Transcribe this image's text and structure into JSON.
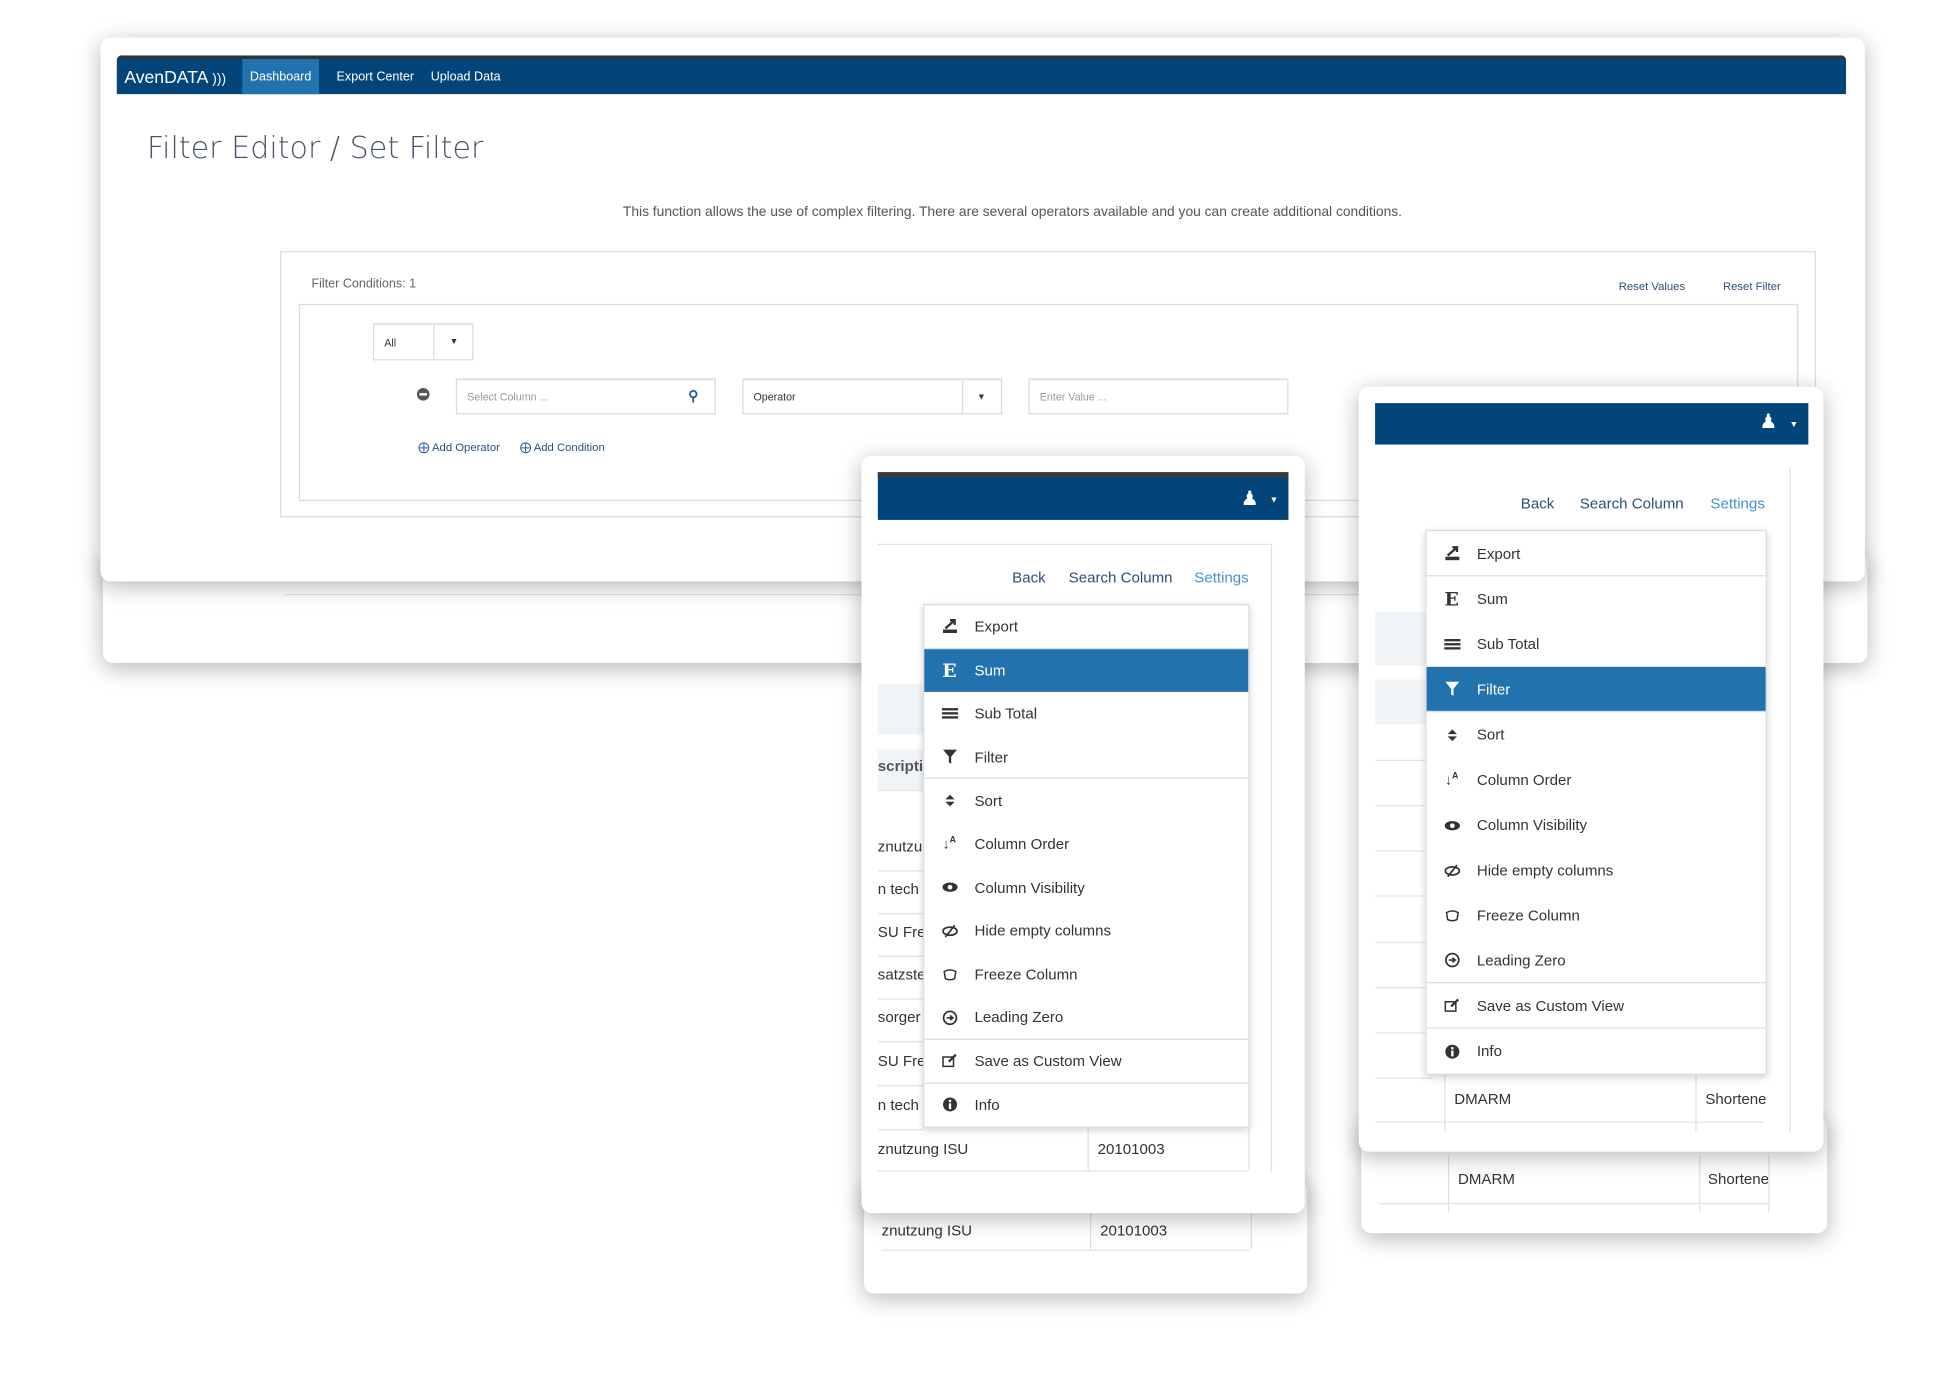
{
  "app": {
    "logo": "AvenDATA",
    "nav": [
      {
        "label": "Dashboard",
        "active": true
      },
      {
        "label": "Export Center"
      },
      {
        "label": "Upload Data"
      }
    ]
  },
  "page": {
    "title": "Filter Editor / Set Filter",
    "description": "This function allows the use of complex filtering. There are several operators available and you can create additional conditions.",
    "filter_conditions_label": "Filter Conditions: 1",
    "reset_values": "Reset Values",
    "reset_filter": "Reset Filter",
    "match_select": "All",
    "column_placeholder": "Select Column ...",
    "operator_select": "Operator",
    "value_placeholder": "Enter Value ...",
    "add_operator": "Add Operator",
    "add_condition": "Add Condition"
  },
  "colors": {
    "navbar": "#02457a",
    "active_tab": "#2173b0",
    "highlight": "#2272ad",
    "settings_link": "#4a90d9"
  },
  "toolbar": {
    "back": "Back",
    "search_column": "Search Column",
    "settings": "Settings"
  },
  "menu_items": [
    {
      "label": "Export",
      "icon": "export-icon"
    },
    {
      "label": "Sum",
      "icon": "sum-icon"
    },
    {
      "label": "Sub Total",
      "icon": "list-icon"
    },
    {
      "label": "Filter",
      "icon": "filter-icon"
    },
    {
      "label": "Sort",
      "icon": "sort-icon"
    },
    {
      "label": "Column Order",
      "icon": "sort-alpha-icon"
    },
    {
      "label": "Column Visibility",
      "icon": "eye-icon"
    },
    {
      "label": "Hide empty columns",
      "icon": "eye-slash-icon"
    },
    {
      "label": "Freeze Column",
      "icon": "freeze-icon"
    },
    {
      "label": "Leading Zero",
      "icon": "arrow-circle-icon"
    },
    {
      "label": "Save as Custom View",
      "icon": "edit-icon"
    },
    {
      "label": "Info",
      "icon": "info-icon"
    }
  ],
  "middle_window": {
    "selected": "Sum",
    "table_fragments": [
      "scriptic",
      "znutzu",
      "n tech",
      "SU Frei",
      "satzste",
      "sorger",
      "SU Frei",
      "n tech"
    ],
    "last_row": {
      "col1": "znutzung ISU",
      "col2": "20101003"
    },
    "behind_row": {
      "col1": "znutzung ISU",
      "col2": "20101003"
    }
  },
  "right_window": {
    "selected": "Filter",
    "last_row": {
      "col1": "DMARM",
      "col2": "Shortene"
    },
    "behind_row": {
      "col1": "DMARM",
      "col2": "Shortene"
    }
  }
}
